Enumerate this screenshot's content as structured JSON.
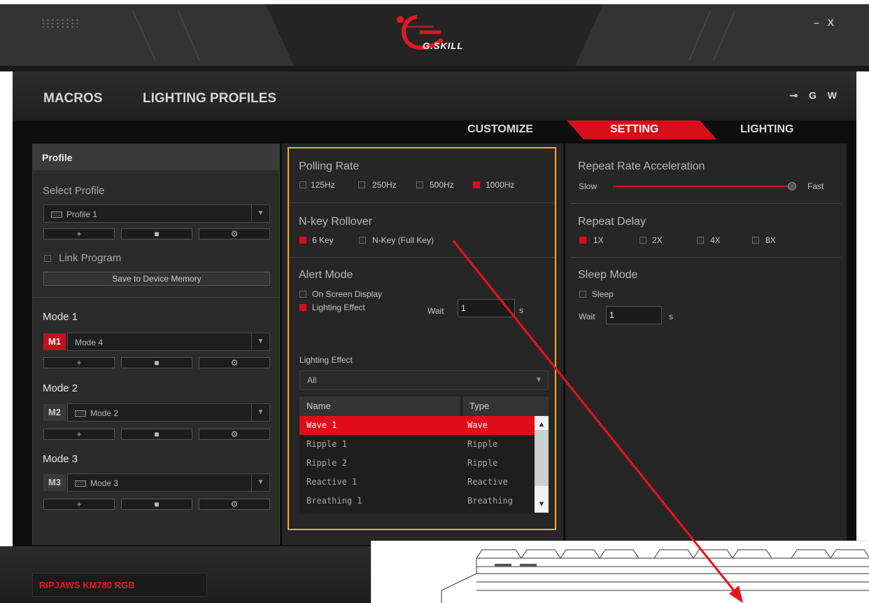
{
  "window": {
    "logo": "G.SKILL",
    "minimize_label": "–",
    "close_label": "X"
  },
  "nav": {
    "macros": "MACROS",
    "lighting_profiles": "LIGHTING PROFILES",
    "icons": [
      "usb-icon",
      "G",
      "W"
    ],
    "g_label": "G",
    "w_label": "W"
  },
  "tabs": {
    "customize": "CUSTOMIZE",
    "setting": "SETTING",
    "lighting": "LIGHTING",
    "active": "SETTING"
  },
  "profile_panel": {
    "title": "Profile",
    "select_profile_label": "Select Profile",
    "selected_profile": "Profile 1",
    "link_program_label": "Link Program",
    "save_button": "Save to Device Memory",
    "modes": [
      {
        "title": "Mode 1",
        "badge": "M1",
        "value": "Mode 4",
        "active": true
      },
      {
        "title": "Mode 2",
        "badge": "M2",
        "value": "Mode 2",
        "active": false
      },
      {
        "title": "Mode 3",
        "badge": "M3",
        "value": "Mode 3",
        "active": false
      }
    ],
    "add_label": "+",
    "delete_label": "■",
    "settings_label": "⚙"
  },
  "settings": {
    "polling_rate": {
      "title": "Polling Rate",
      "options": [
        "125Hz",
        "250Hz",
        "500Hz",
        "1000Hz"
      ],
      "selected": "1000Hz"
    },
    "nkey": {
      "title": "N-key Rollover",
      "options": [
        "6 Key",
        "N-Key (Full Key)"
      ],
      "selected": "6 Key"
    },
    "alert": {
      "title": "Alert Mode",
      "on_screen_display": "On Screen Display",
      "lighting_effect": "Lighting Effect",
      "wait_label": "Wait",
      "wait_value": "1",
      "unit": "s"
    },
    "lighting_effect_list": {
      "label": "Lighting Effect",
      "filter": "All",
      "columns": [
        "Name",
        "Type"
      ],
      "rows": [
        {
          "name": "Wave 1",
          "type": "Wave",
          "selected": true
        },
        {
          "name": "Ripple 1",
          "type": "Ripple",
          "selected": false
        },
        {
          "name": "Ripple 2",
          "type": "Ripple",
          "selected": false
        },
        {
          "name": "Reactive 1",
          "type": "Reactive",
          "selected": false
        },
        {
          "name": "Breathing 1",
          "type": "Breathing",
          "selected": false
        }
      ]
    },
    "repeat_rate": {
      "title": "Repeat Rate Acceleration",
      "min_label": "Slow",
      "max_label": "Fast",
      "value_fraction": 1.0
    },
    "repeat_delay": {
      "title": "Repeat Delay",
      "options": [
        "1X",
        "2X",
        "4X",
        "8X"
      ],
      "selected": "1X"
    },
    "sleep": {
      "title": "Sleep Mode",
      "sleep_label": "Sleep",
      "wait_label": "Wait",
      "wait_value": "1",
      "unit": "s"
    }
  },
  "footer": {
    "model": "RIPJAWS KM780 RGB"
  },
  "colors": {
    "accent_red": "#d80f1a",
    "highlight_yellow": "#f3b01b",
    "annotation_arrow": "#e8141c"
  }
}
